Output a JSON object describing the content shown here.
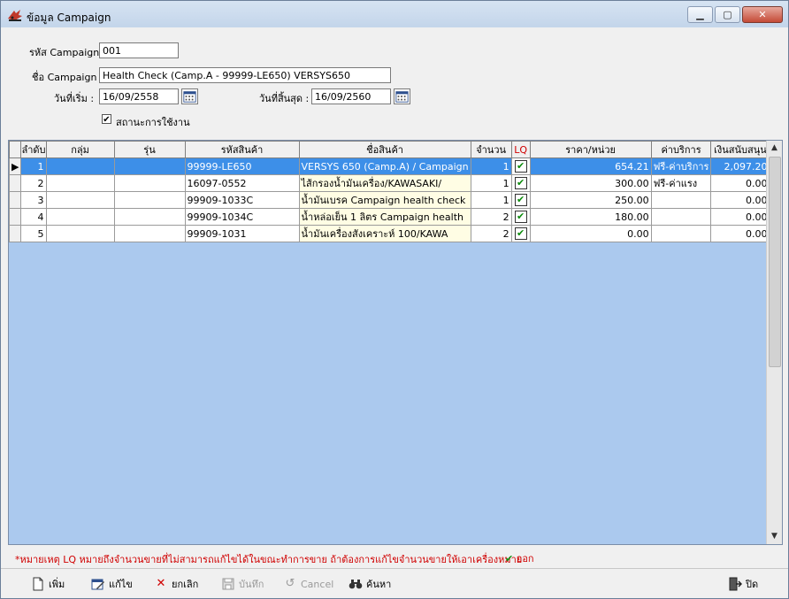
{
  "window": {
    "title": "ข้อมูล Campaign"
  },
  "form": {
    "campaign_code_label": "รหัส Campaign :",
    "campaign_code_value": "001",
    "campaign_name_label": "ชื่อ Campaign :",
    "campaign_name_value": "Health Check (Camp.A - 99999-LE650) VERSYS650",
    "start_date_label": "วันที่เริ่ม :",
    "start_date_value": "16/09/2558",
    "end_date_label": "วันที่สิ้นสุด :",
    "end_date_value": "16/09/2560",
    "status_label": "สถานะการใช้งาน",
    "status_checked": "✔"
  },
  "grid": {
    "headers": [
      "ลำดับ",
      "กลุ่ม",
      "รุ่น",
      "รหัสสินค้า",
      "ชื่อสินค้า",
      "จำนวน",
      "LQ",
      "ราคา/หน่วย",
      "ค่าบริการ",
      "เงินสนับสนุน"
    ],
    "rows": [
      {
        "no": "1",
        "group": "",
        "model": "",
        "code": "99999-LE650",
        "name": "VERSYS 650 (Camp.A) / Campaign",
        "qty": "1",
        "lq": "✔",
        "price": "654.21",
        "service": "ฟรี-ค่าบริการ",
        "support": "2,097.20"
      },
      {
        "no": "2",
        "group": "",
        "model": "",
        "code": "16097-0552",
        "name": "ไส้กรองน้ำมันเครื่อง/KAWASAKI/",
        "qty": "1",
        "lq": "✔",
        "price": "300.00",
        "service": "ฟรี-ค่าแรง",
        "support": "0.00"
      },
      {
        "no": "3",
        "group": "",
        "model": "",
        "code": "99909-1033C",
        "name": "น้ำมันเบรค Campaign health check",
        "qty": "1",
        "lq": "✔",
        "price": "250.00",
        "service": "",
        "support": "0.00"
      },
      {
        "no": "4",
        "group": "",
        "model": "",
        "code": "99909-1034C",
        "name": "น้ำหล่อเย็น 1 ลิตร Campaign health",
        "qty": "2",
        "lq": "✔",
        "price": "180.00",
        "service": "",
        "support": "0.00"
      },
      {
        "no": "5",
        "group": "",
        "model": "",
        "code": "99909-1031",
        "name": "น้ำมันเครื่องสังเคราะห์ 100/KAWA",
        "qty": "2",
        "lq": "✔",
        "price": "0.00",
        "service": "",
        "support": "0.00"
      }
    ]
  },
  "note": {
    "text": "*หมายเหตุ LQ หมายถึงจำนวนขายที่ไม่สามารถแก้ไขได้ในขณะทำการขาย ถ้าต้องการแก้ไขจำนวนขายให้เอาเครื่องหมาย",
    "ok_symbol": "✔",
    "ok_text": "ออก"
  },
  "toolbar": {
    "add": "เพิ่ม",
    "edit": "แก้ไข",
    "cancel_record": "ยกเลิก",
    "save": "บันทึก",
    "cancel": "Cancel",
    "search": "ค้นหา",
    "close": "ปิด"
  }
}
